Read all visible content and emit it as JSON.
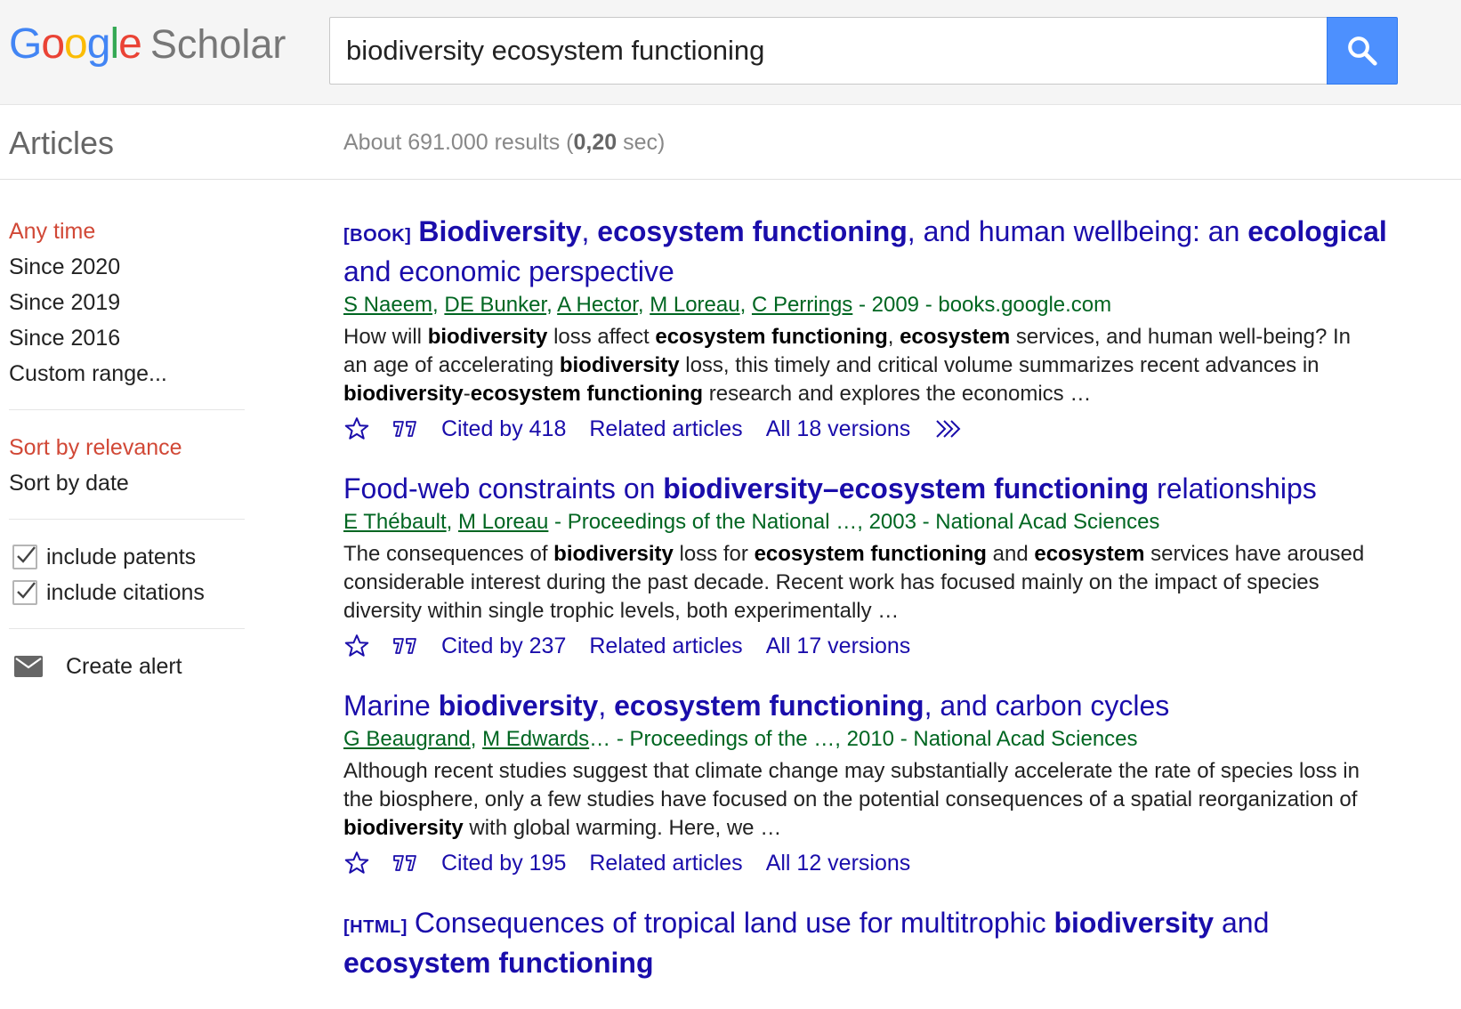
{
  "header": {
    "logo_google_letters": [
      "G",
      "o",
      "o",
      "g",
      "l",
      "e"
    ],
    "logo_scholar": "Scholar",
    "search_value": "biodiversity ecosystem functioning",
    "colors": {
      "blue": "#4285f4",
      "red": "#ea4335",
      "yellow": "#fbbc05",
      "green": "#34a853",
      "search_button": "#4d90fe"
    }
  },
  "subheader": {
    "articles_label": "Articles",
    "stats_prefix": "About 691.000 results (",
    "stats_time": "0,20",
    "stats_suffix": " sec)"
  },
  "sidebar": {
    "time_filters": [
      {
        "label": "Any time",
        "active": true
      },
      {
        "label": "Since 2020",
        "active": false
      },
      {
        "label": "Since 2019",
        "active": false
      },
      {
        "label": "Since 2016",
        "active": false
      },
      {
        "label": "Custom range...",
        "active": false
      }
    ],
    "sort_options": [
      {
        "label": "Sort by relevance",
        "active": true
      },
      {
        "label": "Sort by date",
        "active": false
      }
    ],
    "include_patents": "include patents",
    "include_citations": "include citations",
    "create_alert": "Create alert"
  },
  "results": [
    {
      "tag": "[BOOK]",
      "title_parts": [
        {
          "t": "Biodiversity",
          "b": true
        },
        {
          "t": ", ",
          "b": false
        },
        {
          "t": "ecosystem functioning",
          "b": true
        },
        {
          "t": ", and human wellbeing: an ",
          "b": false
        },
        {
          "t": "ecological",
          "b": true
        },
        {
          "t": " and economic perspective",
          "b": false
        }
      ],
      "authors": [
        "S Naeem",
        "DE Bunker",
        "A Hector",
        "M Loreau",
        "C Perrings"
      ],
      "authors_ellipsis": "",
      "source": " - 2009 - books.google.com",
      "snippet_parts": [
        {
          "t": "How will ",
          "b": false
        },
        {
          "t": "biodiversity",
          "b": true
        },
        {
          "t": " loss affect ",
          "b": false
        },
        {
          "t": "ecosystem functioning",
          "b": true
        },
        {
          "t": ", ",
          "b": false
        },
        {
          "t": "ecosystem",
          "b": true
        },
        {
          "t": " services, and human well-being? In an age of accelerating ",
          "b": false
        },
        {
          "t": "biodiversity",
          "b": true
        },
        {
          "t": " loss, this timely and critical volume summarizes recent advances in ",
          "b": false
        },
        {
          "t": "biodiversity",
          "b": true
        },
        {
          "t": "-",
          "b": false
        },
        {
          "t": "ecosystem functioning",
          "b": true
        },
        {
          "t": " research and explores the economics …",
          "b": false
        }
      ],
      "cited_by": "Cited by 418",
      "related": "Related articles",
      "versions": "All 18 versions",
      "has_more": true
    },
    {
      "tag": "",
      "title_parts": [
        {
          "t": "Food-web constraints on ",
          "b": false
        },
        {
          "t": "biodiversity–ecosystem functioning",
          "b": true
        },
        {
          "t": " relationships",
          "b": false
        }
      ],
      "authors": [
        "E Thébault",
        "M Loreau"
      ],
      "authors_ellipsis": "",
      "source": " - Proceedings of the National …, 2003 - National Acad Sciences",
      "snippet_parts": [
        {
          "t": "The consequences of ",
          "b": false
        },
        {
          "t": "biodiversity",
          "b": true
        },
        {
          "t": " loss for ",
          "b": false
        },
        {
          "t": "ecosystem functioning",
          "b": true
        },
        {
          "t": " and ",
          "b": false
        },
        {
          "t": "ecosystem",
          "b": true
        },
        {
          "t": " services have aroused considerable interest during the past decade. Recent work has focused mainly on the impact of species diversity within single trophic levels, both experimentally …",
          "b": false
        }
      ],
      "cited_by": "Cited by 237",
      "related": "Related articles",
      "versions": "All 17 versions",
      "has_more": false
    },
    {
      "tag": "",
      "title_parts": [
        {
          "t": "Marine ",
          "b": false
        },
        {
          "t": "biodiversity",
          "b": true
        },
        {
          "t": ", ",
          "b": false
        },
        {
          "t": "ecosystem functioning",
          "b": true
        },
        {
          "t": ", and carbon cycles",
          "b": false
        }
      ],
      "authors": [
        "G Beaugrand",
        "M Edwards"
      ],
      "authors_ellipsis": "…",
      "source": " - Proceedings of the …, 2010 - National Acad Sciences",
      "snippet_parts": [
        {
          "t": "Although recent studies suggest that climate change may substantially accelerate the rate of species loss in the biosphere, only a few studies have focused on the potential consequences of a spatial reorganization of ",
          "b": false
        },
        {
          "t": "biodiversity",
          "b": true
        },
        {
          "t": " with global warming. Here, we …",
          "b": false
        }
      ],
      "cited_by": "Cited by 195",
      "related": "Related articles",
      "versions": "All 12 versions",
      "has_more": false
    },
    {
      "tag": "[HTML]",
      "title_parts": [
        {
          "t": "Consequences of tropical land use for multitrophic ",
          "b": false
        },
        {
          "t": "biodiversity",
          "b": true
        },
        {
          "t": " and ",
          "b": false
        },
        {
          "t": "ecosystem functioning",
          "b": true
        }
      ],
      "authors": [],
      "authors_ellipsis": "",
      "source": "",
      "snippet_parts": [],
      "cited_by": "",
      "related": "",
      "versions": "",
      "has_more": false
    }
  ]
}
